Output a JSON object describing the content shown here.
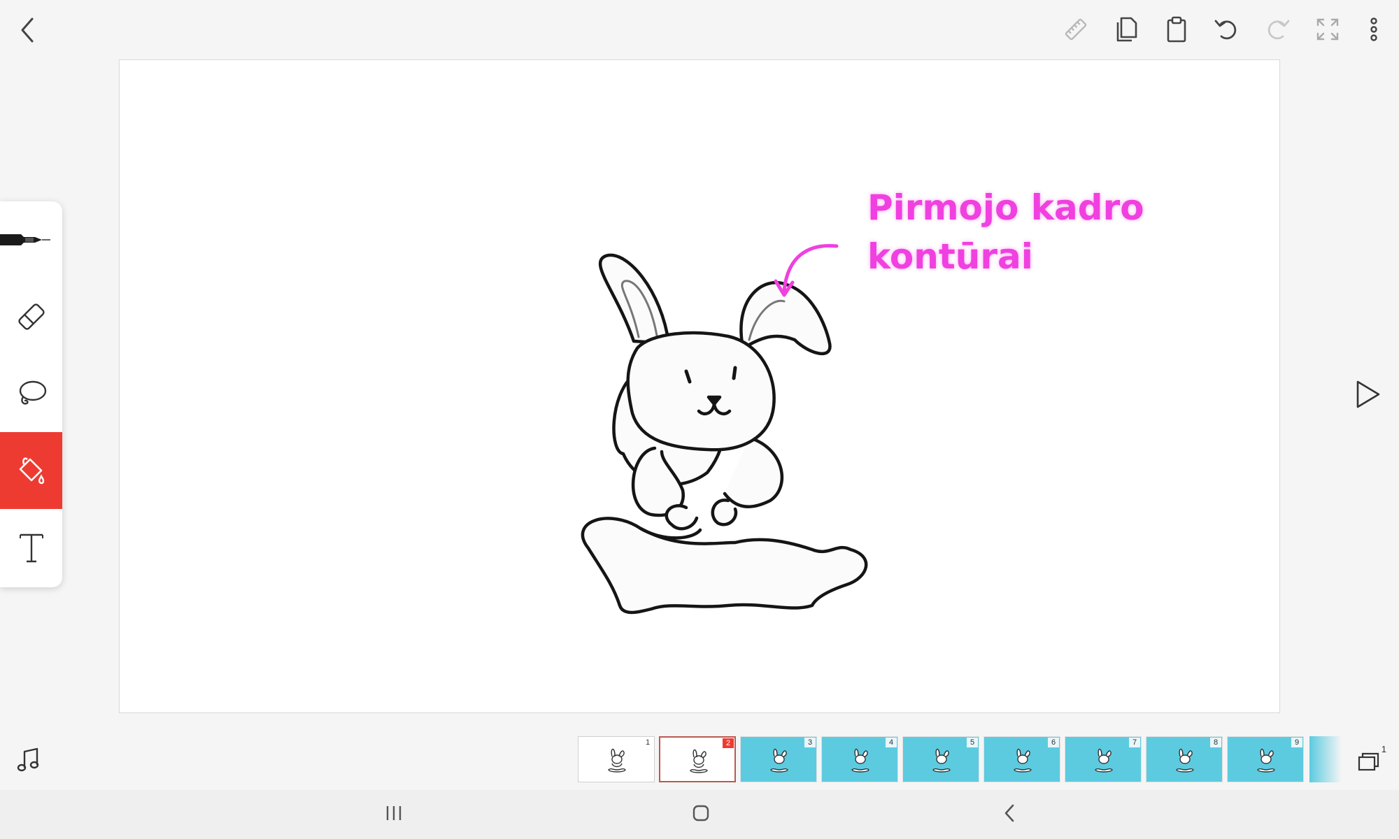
{
  "top_toolbar": {
    "back_icon": "chevron-left-icon",
    "icons": [
      "ruler-icon",
      "copy-icon",
      "clipboard-icon",
      "undo-icon",
      "redo-icon",
      "fullscreen-icon",
      "more-vert-icon"
    ]
  },
  "tools": [
    {
      "name": "pen",
      "icon": "pen-icon",
      "active": false
    },
    {
      "name": "eraser",
      "icon": "eraser-icon",
      "active": false
    },
    {
      "name": "lasso",
      "icon": "lasso-icon",
      "active": false
    },
    {
      "name": "fill",
      "icon": "paint-bucket-icon",
      "active": true
    },
    {
      "name": "text",
      "icon": "text-icon",
      "active": false
    }
  ],
  "canvas": {
    "annotation": {
      "line1": "Pirmojo kadro",
      "line2": "kontūrai",
      "color": "#f040e0"
    }
  },
  "play_icon": "play-icon",
  "music_icon": "music-note-icon",
  "timeline": {
    "frames": [
      {
        "number": "1",
        "style": "plain"
      },
      {
        "number": "2",
        "style": "selected"
      },
      {
        "number": "3",
        "style": "onion"
      },
      {
        "number": "4",
        "style": "onion"
      },
      {
        "number": "5",
        "style": "onion"
      },
      {
        "number": "6",
        "style": "onion"
      },
      {
        "number": "7",
        "style": "onion"
      },
      {
        "number": "8",
        "style": "onion"
      },
      {
        "number": "9",
        "style": "onion"
      }
    ],
    "layers_count": "1"
  },
  "colors": {
    "accent": "#ee3b32",
    "onion_skin": "#5ccbe0",
    "annotation": "#f040e0"
  },
  "system_nav": {
    "icons": [
      "recent-apps-icon",
      "home-icon",
      "back-icon"
    ]
  }
}
